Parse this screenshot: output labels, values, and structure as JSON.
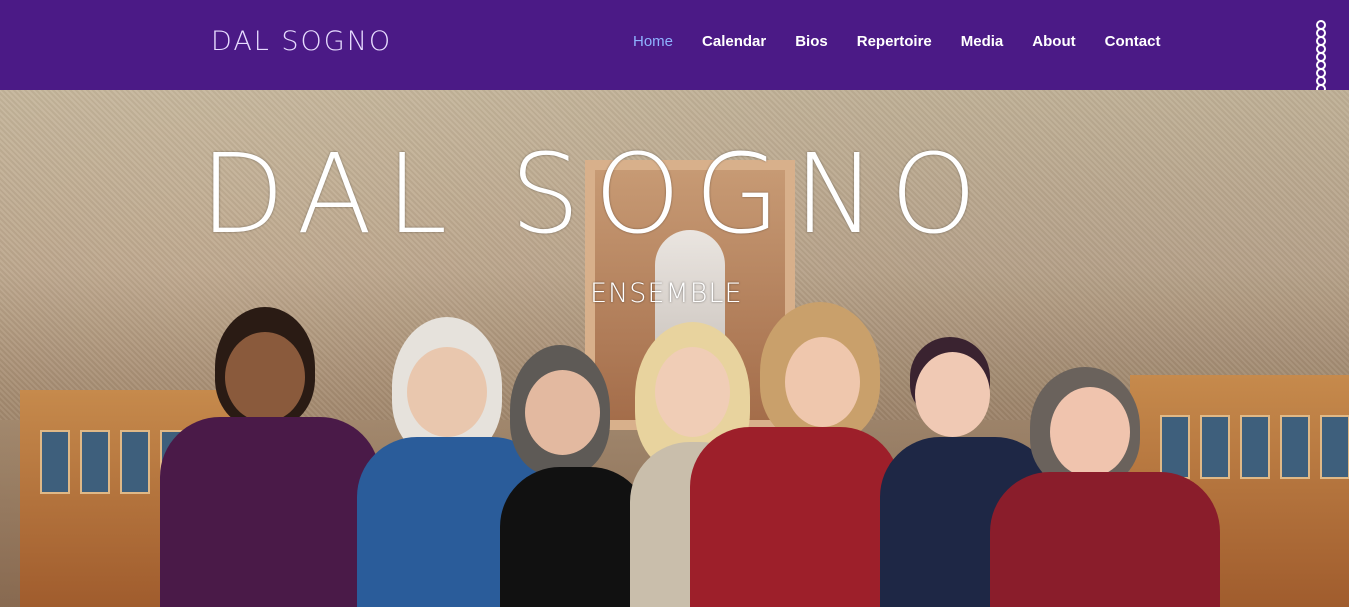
{
  "header": {
    "logo": "DAL SOGNO",
    "nav": [
      {
        "label": "Home",
        "active": true
      },
      {
        "label": "Calendar",
        "active": false
      },
      {
        "label": "Bios",
        "active": false
      },
      {
        "label": "Repertoire",
        "active": false
      },
      {
        "label": "Media",
        "active": false
      },
      {
        "label": "About",
        "active": false
      },
      {
        "label": "Contact",
        "active": false
      }
    ],
    "menu_icon": "dots-vertical-icon"
  },
  "hero": {
    "title": "DAL SOGNO",
    "subtitle": "ENSEMBLE"
  },
  "colors": {
    "header_bg": "#4b1a86",
    "nav_active": "#8fb3ff"
  }
}
